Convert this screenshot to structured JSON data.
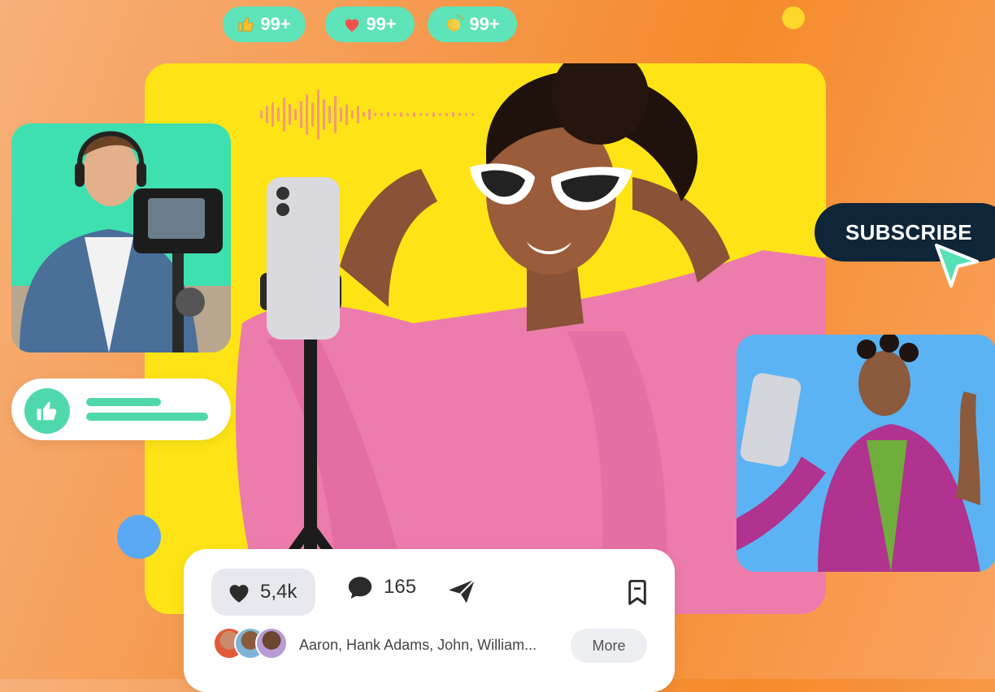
{
  "reactions": [
    {
      "icon": "thumbs-up-icon",
      "count": "99+"
    },
    {
      "icon": "heart-icon",
      "count": "99+"
    },
    {
      "icon": "clapping-hands-icon",
      "count": "99+"
    }
  ],
  "subscribe_button": {
    "label": "SUBSCRIBE"
  },
  "post": {
    "likes": "5,4k",
    "comments": "165",
    "liked_by": "Aaron, Hank Adams, John, William...",
    "more_label": "More"
  },
  "colors": {
    "accent_green": "#4fd8ac",
    "main_yellow": "#fee416",
    "dark_navy": "#0f2538",
    "blue": "#5bb3f4"
  }
}
